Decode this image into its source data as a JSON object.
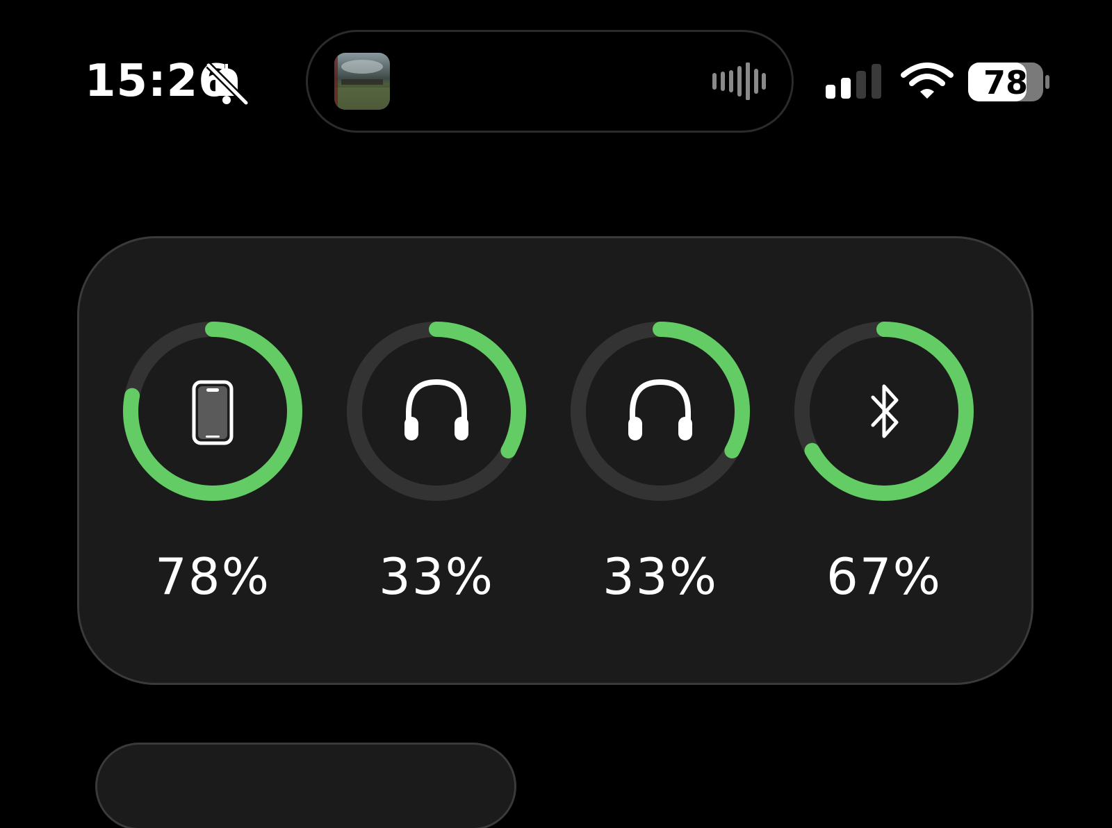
{
  "status_bar": {
    "time": "15:26",
    "silent_icon": "bell-slash-icon",
    "signal_icon": "cellular-signal-icon",
    "wifi_icon": "wifi-icon",
    "battery_level": "78",
    "battery_fraction": 0.78
  },
  "dynamic_island": {
    "album_art_icon": "album-artwork",
    "activity_icon": "waveform-icon"
  },
  "battery_widget": {
    "accent_color": "#64CC64",
    "track_color": "#333333",
    "devices": [
      {
        "icon": "iphone-icon",
        "label": "78%",
        "level": 0.78
      },
      {
        "icon": "headphones-icon",
        "label": "33%",
        "level": 0.33
      },
      {
        "icon": "headphones-icon",
        "label": "33%",
        "level": 0.33
      },
      {
        "icon": "bluetooth-icon",
        "label": "67%",
        "level": 0.67
      }
    ]
  }
}
